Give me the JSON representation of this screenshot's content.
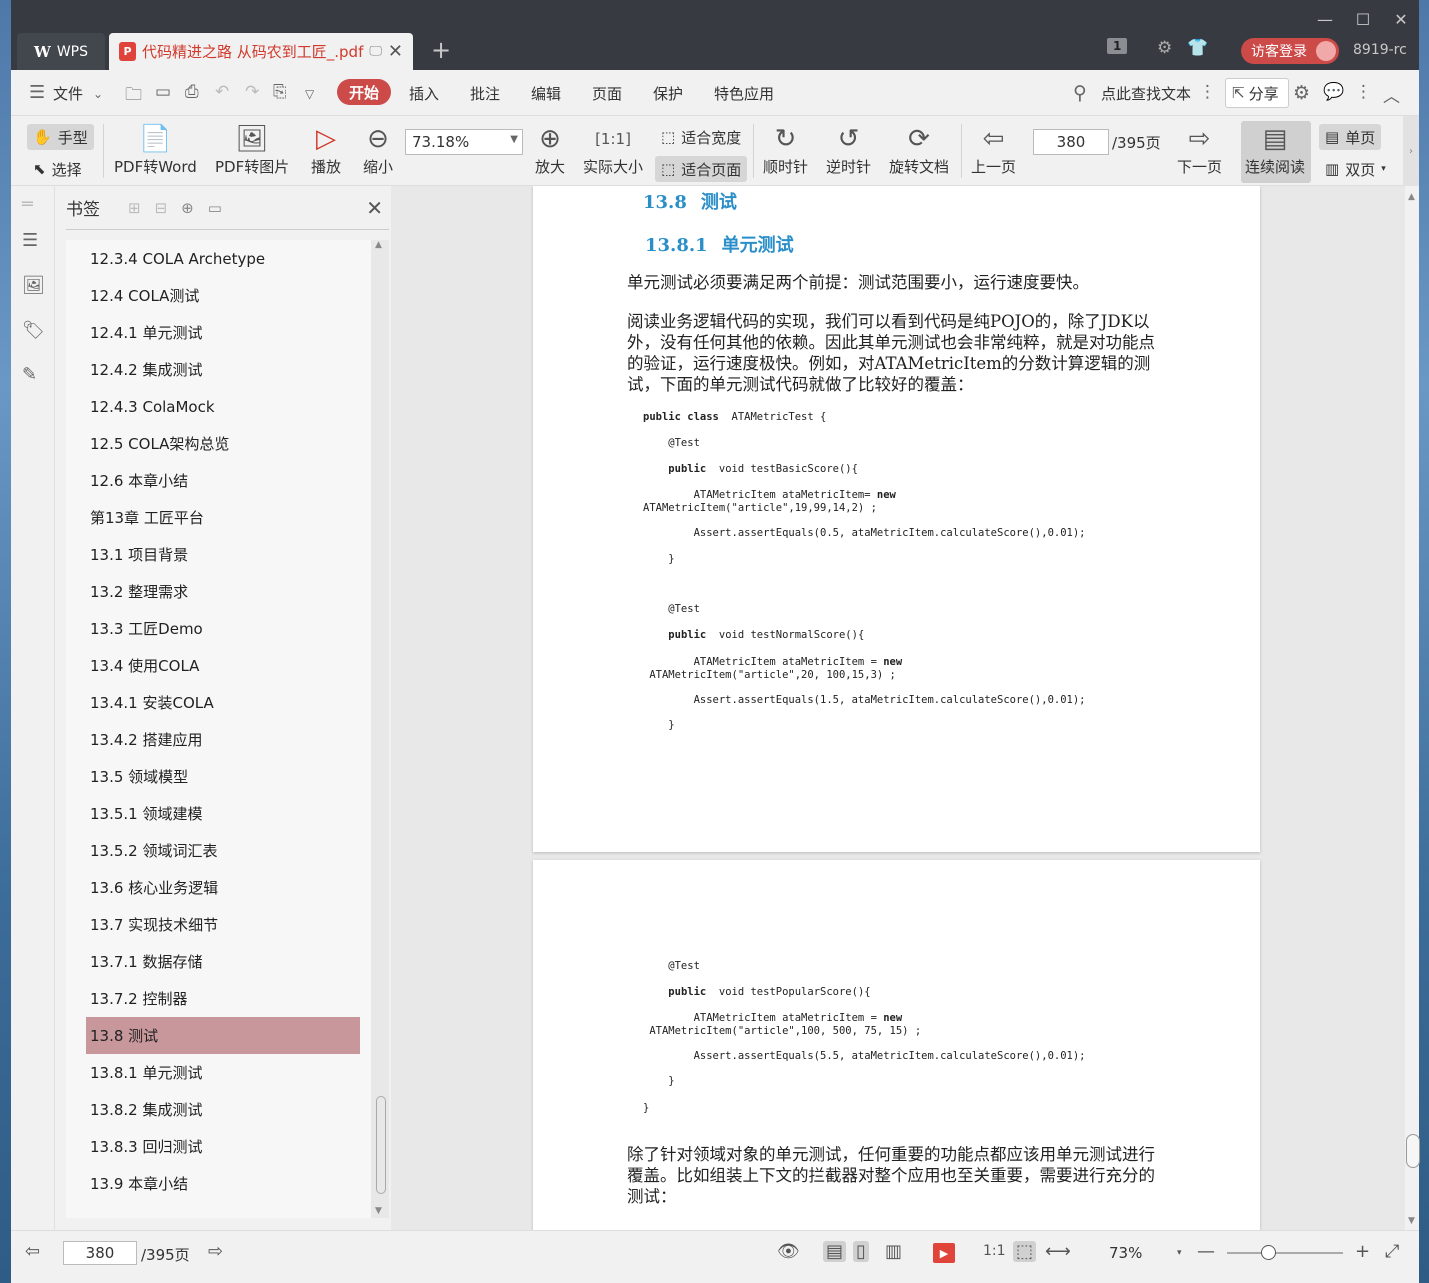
{
  "titlebar": {
    "wps_label": "WPS",
    "doc_tab_title": "代码精进之路 从码农到工匠_.pdf",
    "page_badge": "1",
    "login_label": "访客登录",
    "user_id": "8919-rc"
  },
  "menu": {
    "file": "文件",
    "items": [
      "开始",
      "插入",
      "批注",
      "编辑",
      "页面",
      "保护",
      "特色应用"
    ],
    "search": "点此查找文本",
    "share": "分享"
  },
  "toolbar": {
    "hand": "手型",
    "select": "选择",
    "pdf_to_word": "PDF转Word",
    "pdf_to_image": "PDF转图片",
    "play": "播放",
    "zoom_out": "缩小",
    "zoom_value": "73.18%",
    "fit_width": "适合宽度",
    "fit_page": "适合页面",
    "zoom_in": "放大",
    "actual_size": "实际大小",
    "clockwise": "顺时针",
    "counter_clockwise": "逆时针",
    "rotate_doc": "旋转文档",
    "prev_page": "上一页",
    "page_input": "380",
    "page_total": "/395页",
    "next_page": "下一页",
    "continuous": "连续阅读",
    "single": "单页",
    "double": "双页"
  },
  "bookmarks": {
    "title": "书签",
    "items": [
      "12.3.4 COLA Archetype",
      "12.4 COLA测试",
      "12.4.1 单元测试",
      "12.4.2 集成测试",
      "12.4.3 ColaMock",
      "12.5 COLA架构总览",
      "12.6 本章小结",
      "第13章 工匠平台",
      "13.1 项目背景",
      "13.2 整理需求",
      "13.3 工匠Demo",
      "13.4 使用COLA",
      "13.4.1 安装COLA",
      "13.4.2 搭建应用",
      "13.5 领域模型",
      "13.5.1 领域建模",
      "13.5.2 领域词汇表",
      "13.6 核心业务逻辑",
      "13.7 实现技术细节",
      "13.7.1 数据存储",
      "13.7.2 控制器",
      "13.8 测试",
      "13.8.1 单元测试",
      "13.8.2 集成测试",
      "13.8.3 回归测试",
      "13.9 本章小结"
    ],
    "selected_index": 21
  },
  "document": {
    "h_num1": "13.8",
    "h_txt1": "测试",
    "h_num2": "13.8.1",
    "h_txt2": "单元测试",
    "para1": "单元测试必须要满足两个前提：测试范围要小，运行速度要快。",
    "para2": "阅读业务逻辑代码的实现，我们可以看到代码是纯POJO的，除了JDK以外，没有任何其他的依赖。因此其单元测试也会非常纯粹，就是对功能点的验证，运行速度极快。例如，对ATAMetricItem的分数计算逻辑的测试，下面的单元测试代码就做了比较好的覆盖：",
    "code1": [
      "public class  ATAMetricTest {",
      "    @Test",
      "    public  void testBasicScore(){",
      "        ATAMetricItem ataMetricItem= new",
      "ATAMetricItem(\"article\",19,99,14,2) ;",
      "        Assert.assertEquals(0.5, ataMetricItem.calculateScore(),0.01);",
      "    }",
      "    @Test",
      "    public  void testNormalScore(){",
      "        ATAMetricItem ataMetricItem = new",
      " ATAMetricItem(\"article\",20, 100,15,3) ;",
      "        Assert.assertEquals(1.5, ataMetricItem.calculateScore(),0.01);",
      "    }"
    ],
    "code2": [
      "    @Test",
      "    public  void testPopularScore(){",
      "        ATAMetricItem ataMetricItem = new",
      " ATAMetricItem(\"article\",100, 500, 75, 15) ;",
      "        Assert.assertEquals(5.5, ataMetricItem.calculateScore(),0.01);",
      "    }",
      "}"
    ],
    "para3": "除了针对领域对象的单元测试，任何重要的功能点都应该用单元测试进行覆盖。比如组装上下文的拦截器对整个应用也至关重要，需要进行充分的测试："
  },
  "statusbar": {
    "page_input": "380",
    "page_total": "/395页",
    "zoom": "73%"
  },
  "colors": {
    "accent": "#cc4a48",
    "heading": "#2a8fc8",
    "selected": "#c8979b"
  }
}
